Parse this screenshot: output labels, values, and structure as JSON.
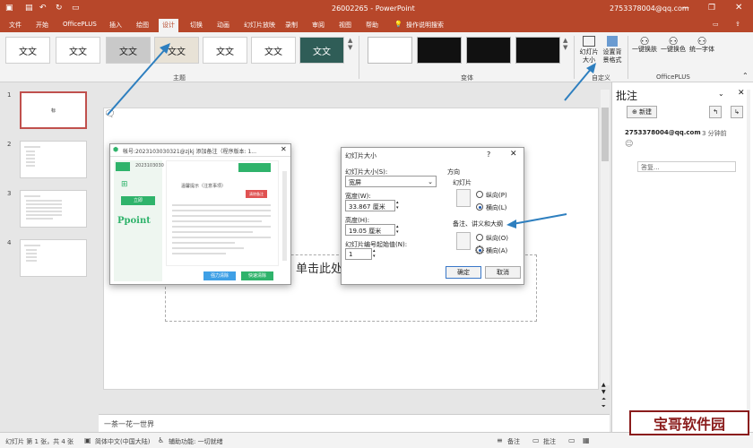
{
  "title_bar": {
    "title": "26002265  -  PowerPoint",
    "account": "2753378004@qq.com"
  },
  "tabs": [
    "文件",
    "开始",
    "OfficePLUS",
    "插入",
    "绘图",
    "设计",
    "切换",
    "动画",
    "幻灯片放映",
    "录制",
    "审阅",
    "视图",
    "帮助"
  ],
  "active_tab": "设计",
  "tell_me": "操作说明搜索",
  "themes": [
    "文文",
    "文文",
    "文文",
    "文文",
    "文文",
    "文文",
    "文文"
  ],
  "ribbon": {
    "group_theme": "主题",
    "group_variant": "变体",
    "group_custom": "自定义",
    "group_officeplus": "OfficePLUS",
    "slide_size": "幻灯片\n大小",
    "format_bg": "设置背\n景格式",
    "one_key_replace": "一键换肤",
    "one_key_color": "一键换色",
    "unify_font": "统一字体"
  },
  "slide_numbers": [
    "1",
    "2",
    "3",
    "4"
  ],
  "slide1_text": "标",
  "slide_body_text": "单击此处",
  "notes_text": "一茶一花一世界",
  "plugin_dialog": {
    "title": "帐号:2023103030321@zjkj  添加备注（程序版本: 1...",
    "id_label": "2023103030",
    "brand": "Ppoint",
    "left_btn": "立即",
    "button1": "强力清除",
    "button2": "快速清除",
    "red_btn": "清除备注",
    "notice": "温馨提示（注意事项）"
  },
  "size_dialog": {
    "title": "幻灯片大小",
    "help": "?",
    "size_label": "幻灯片大小(S):",
    "size_value": "宽屏",
    "width_label": "宽度(W):",
    "width_value": "33.867 厘米",
    "height_label": "高度(H):",
    "height_value": "19.05 厘米",
    "start_label": "幻灯片编号起始值(N):",
    "start_value": "1",
    "orientation": "方向",
    "slides": "幻灯片",
    "portrait": "纵向(P)",
    "landscape": "横向(L)",
    "notes_section": "备注、讲义和大纲",
    "notes_portrait": "纵向(O)",
    "notes_landscape": "横向(A)",
    "ok": "确定",
    "cancel": "取消"
  },
  "comments_pane": {
    "title": "批注",
    "new": "新建",
    "author": "2753378004@qq.com",
    "time": "3 分钟前",
    "reply_placeholder": "答复..."
  },
  "status_bar": {
    "slide_info": "幻灯片 第 1 张，共 4 张",
    "language": "简体中文(中国大陆)",
    "accessibility": "辅助功能: 一切就绪",
    "notes": "备注",
    "comments": "批注"
  },
  "watermark": "宝哥软件园",
  "colors": {
    "accent": "#b7472a",
    "arrow": "#2e7fbf",
    "green": "#2fb36b"
  }
}
